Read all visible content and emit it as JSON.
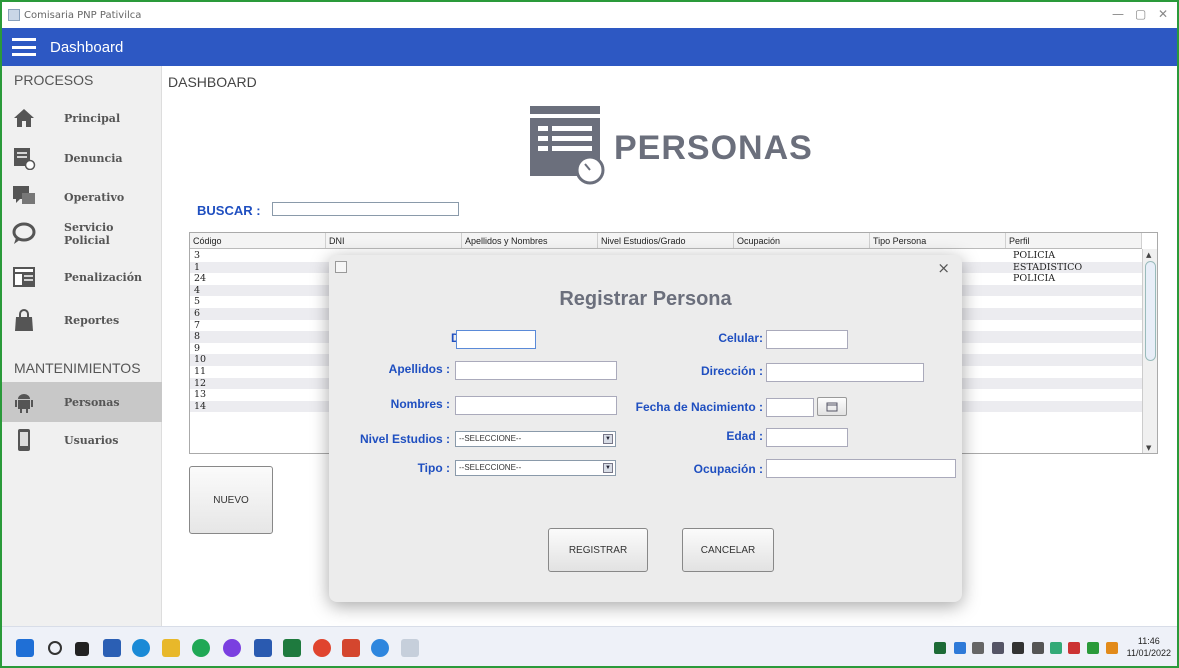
{
  "window": {
    "title": "Comisaria PNP Pativilca"
  },
  "appbar": {
    "title": "Dashboard"
  },
  "sidebar": {
    "section_procesos": "PROCESOS",
    "section_mantenimientos": "MANTENIMIENTOS",
    "items": [
      {
        "label": "Principal",
        "icon": "home-icon"
      },
      {
        "label": "Denuncia",
        "icon": "document-clock-icon"
      },
      {
        "label": "Operativo",
        "icon": "chat-bubbles-icon"
      },
      {
        "label": "Servicio Policial",
        "icon": "speech-bubble-icon"
      },
      {
        "label": "Penalización",
        "icon": "list-panel-icon"
      },
      {
        "label": "Reportes",
        "icon": "shopping-bag-icon"
      },
      {
        "label": "Personas",
        "icon": "android-icon",
        "active": true
      },
      {
        "label": "Usuarios",
        "icon": "phone-icon"
      }
    ]
  },
  "main": {
    "title": "DASHBOARD",
    "hero_text": "PERSONAS",
    "search_label": "BUSCAR :",
    "new_button": "NUEVO"
  },
  "table": {
    "columns": [
      "Código",
      "DNI",
      "Apellidos y Nombres",
      "Nivel Estudios/Grado",
      "Ocupación",
      "Tipo Persona",
      "Perfil"
    ],
    "rows": [
      {
        "codigo": "3",
        "perfil": "POLICIA"
      },
      {
        "codigo": "1",
        "perfil": "ESTADISTICO"
      },
      {
        "codigo": "24",
        "perfil": "POLICIA"
      },
      {
        "codigo": "4",
        "perfil": ""
      },
      {
        "codigo": "5",
        "perfil": ""
      },
      {
        "codigo": "6",
        "perfil": ""
      },
      {
        "codigo": "7",
        "perfil": ""
      },
      {
        "codigo": "8",
        "perfil": ""
      },
      {
        "codigo": "9",
        "perfil": ""
      },
      {
        "codigo": "10",
        "perfil": ""
      },
      {
        "codigo": "11",
        "perfil": ""
      },
      {
        "codigo": "12",
        "perfil": ""
      },
      {
        "codigo": "13",
        "perfil": ""
      },
      {
        "codigo": "14",
        "perfil": ""
      }
    ]
  },
  "dialog": {
    "title": "Registrar Persona",
    "close": "×",
    "labels": {
      "dni": "DNI :",
      "apellidos": "Apellidos :",
      "nombres": "Nombres :",
      "nivel_estudios": "Nivel Estudios :",
      "tipo": "Tipo :",
      "celular": "Celular:",
      "direccion": "Dirección :",
      "fecha_nacimiento": "Fecha de Nacimiento :",
      "edad": "Edad :",
      "ocupacion": "Ocupación :"
    },
    "nivel_estudios_selected": "--SELECCIONE--",
    "tipo_selected": "--SELECCIONE--",
    "register_button": "REGISTRAR",
    "cancel_button": "CANCELAR"
  },
  "taskbar": {
    "time": "11:46",
    "date": "11/01/2022"
  },
  "colors": {
    "appbar": "#2d58c3",
    "label_blue": "#1f4fc0",
    "window_border": "#2a9a3a"
  }
}
